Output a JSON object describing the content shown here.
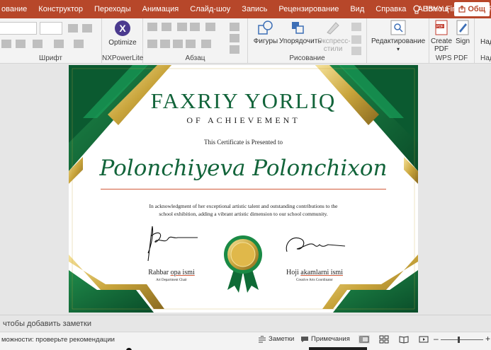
{
  "menu": {
    "tabs": [
      "ование",
      "Конструктор",
      "Переходы",
      "Анимация",
      "Слайд-шоу",
      "Запись",
      "Рецензирование",
      "Вид",
      "Справка",
      "ABBYY FineReader PDF"
    ],
    "help": "Помощ",
    "share": "Общ"
  },
  "ribbon": {
    "font_group": "Шрифт",
    "nx_optimize": "Optimize",
    "nx_group": "NXPowerLite",
    "para_group": "Абзац",
    "shapes": "Фигуры",
    "arrange": "Упорядочить",
    "quick_styles_1": "Экспресс-",
    "quick_styles_2": "стили",
    "drawing_group": "Рисование",
    "editing": "Редактирование",
    "create_pdf_1": "Create",
    "create_pdf_2": "PDF",
    "sign": "Sign",
    "wps_group": "WPS PDF",
    "right_cut": "Над",
    "right_cut_2": "Над"
  },
  "certificate": {
    "title": "FAXRIY YORLIQ",
    "subtitle": "OF ACHIEVEMENT",
    "presented": "This Certificate is Presented to",
    "name": "Polonchiyeva Polonchixon",
    "body_line1": "In acknowledgment of her exceptional artistic talent and outstanding contributions to the",
    "body_line2": "school exhibition, adding a vibrant artistic dimension to our school community.",
    "left_sig_first": "Rahbar",
    "left_sig_rest": "opa ismi",
    "left_sig_role": "Art Department Chair",
    "right_sig_first": "Hoji",
    "right_sig_rest": "akamlarni ismi",
    "right_sig_role": "Creative Arts Coordinator"
  },
  "notes": {
    "placeholder": "чтобы добавить заметки"
  },
  "status": {
    "accessibility": "можности: проверьте рекомендации",
    "notes_btn": "Заметки",
    "comments_btn": "Примечания",
    "zoom_minus": "–",
    "zoom_plus": "+"
  },
  "colors": {
    "accent": "#b7472a",
    "cert_green": "#12643a",
    "gold": "#c9a53c"
  }
}
